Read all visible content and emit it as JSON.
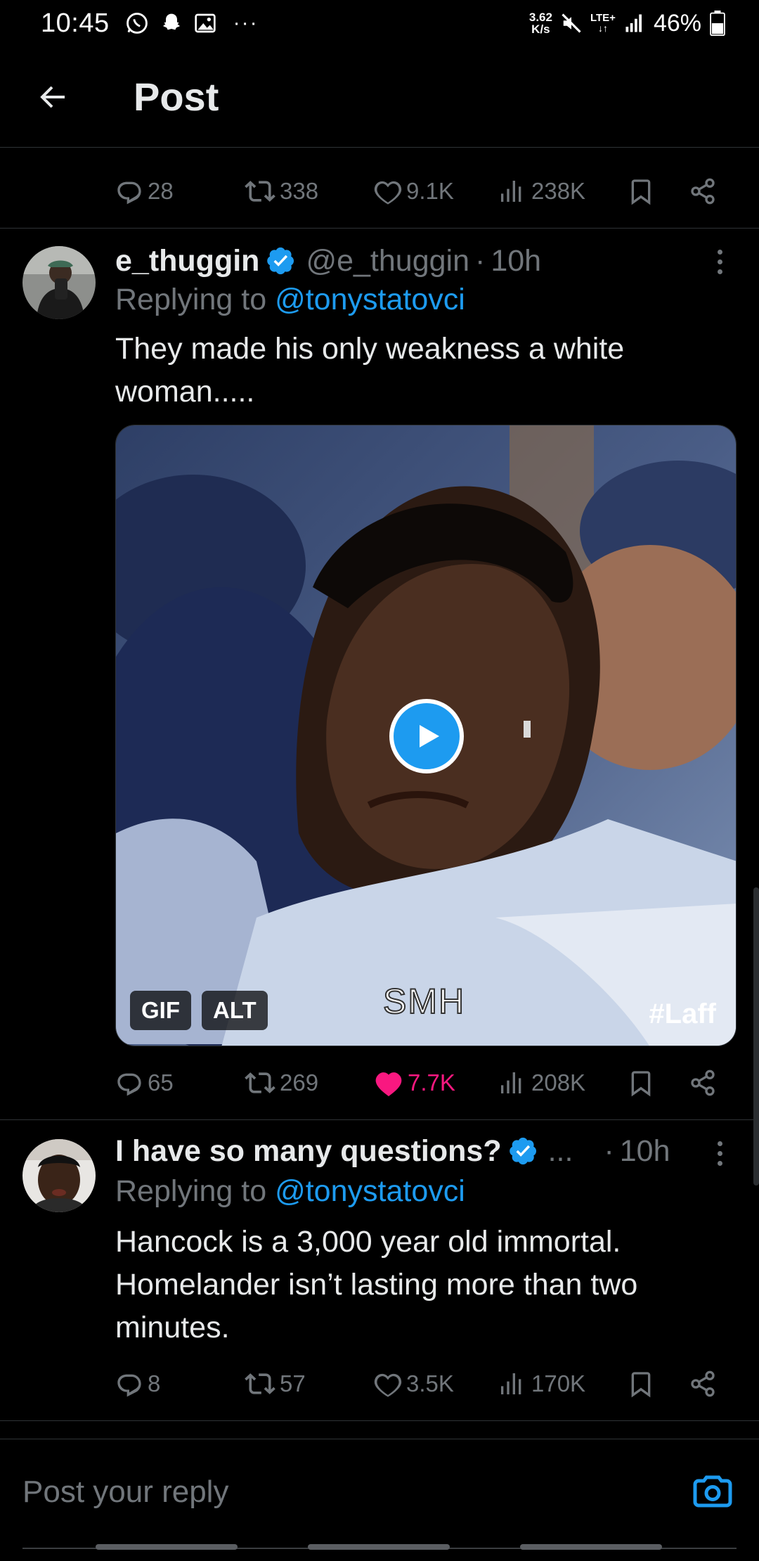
{
  "status_bar": {
    "time": "10:45",
    "speed_value": "3.62",
    "speed_unit": "K/s",
    "network": "LTE+",
    "battery": "46%"
  },
  "header": {
    "title": "Post"
  },
  "main_post_actions": {
    "replies": "28",
    "reposts": "338",
    "likes": "9.1K",
    "views": "238K"
  },
  "replies": [
    {
      "display_name": "e_thuggin",
      "handle": "@e_thuggin",
      "separator": "·",
      "time": "10h",
      "replying_prefix": "Replying to ",
      "replying_to": "@tonystatovci",
      "text": "They made his only weakness a white woman.....",
      "media": {
        "badge_gif": "GIF",
        "badge_alt": "ALT",
        "caption": "SMH",
        "watermark": "#Laff"
      },
      "actions": {
        "replies": "65",
        "reposts": "269",
        "likes": "7.7K",
        "views": "208K",
        "liked": true
      }
    },
    {
      "display_name": "I have so many questions?",
      "name_ellipsis": "...",
      "separator": "·",
      "time": "10h",
      "replying_prefix": "Replying to ",
      "replying_to": "@tonystatovci",
      "text_line1": "Hancock is a 3,000 year old immortal.",
      "text_line2": "Homelander isn’t lasting more than two minutes.",
      "actions": {
        "replies": "8",
        "reposts": "57",
        "likes": "3.5K",
        "views": "170K"
      }
    }
  ],
  "composer": {
    "placeholder": "Post your reply"
  },
  "colors": {
    "accent": "#1d9bf0",
    "like": "#f91880",
    "muted": "#71767b",
    "border": "#2f3336"
  },
  "icons": [
    "back-arrow-icon",
    "reply-icon",
    "repost-icon",
    "like-icon",
    "views-icon",
    "bookmark-icon",
    "share-icon",
    "verified-icon",
    "more-icon",
    "play-icon",
    "camera-icon",
    "whatsapp-icon",
    "snapchat-icon",
    "gallery-icon",
    "mute-icon",
    "signal-icon",
    "battery-icon"
  ]
}
